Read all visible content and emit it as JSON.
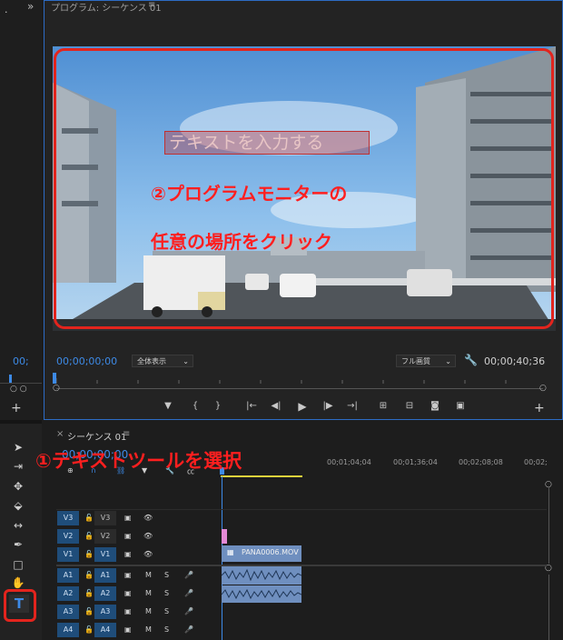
{
  "left_panel": {
    "chevron": "»",
    "timecode": "00;",
    "add": "+"
  },
  "program": {
    "title": "プログラム: シーケンス 01",
    "menu_icon": "≡",
    "timecode_left": "00;00;00;00",
    "fit_label": "全体表示",
    "quality_label": "フル画質",
    "timecode_right": "00;00;40;36",
    "overlay_text": "テキストを入力する",
    "annotation_line1": "②プログラムモニターの",
    "annotation_line2": "任意の場所をクリック",
    "add": "+"
  },
  "timeline": {
    "close": "×",
    "tab_title": "シーケンス 01",
    "menu_icon": "≡",
    "timecode": "00;00;00;00",
    "annotation": "①テキストツールを選択",
    "ruler_marks": [
      "00;01;04;04",
      "00;01;36;04",
      "00;02;08;08",
      "00;02;"
    ],
    "tracks": [
      {
        "src": "V3",
        "dst": "V3"
      },
      {
        "src": "V2",
        "dst": "V2"
      },
      {
        "src": "V1",
        "dst": "V1"
      },
      {
        "src": "A1",
        "dst": "A1"
      },
      {
        "src": "A2",
        "dst": "A2"
      },
      {
        "src": "A3",
        "dst": "A3"
      },
      {
        "src": "A4",
        "dst": "A4"
      }
    ],
    "clip_name": "PANA0006.MOV",
    "m_label": "M",
    "s_label": "S"
  },
  "tools": [
    "select-tool",
    "track-select-tool",
    "ripple-tool",
    "razor-tool",
    "slip-tool",
    "pen-tool",
    "rectangle-tool",
    "hand-tool",
    "type-tool"
  ],
  "type_tool_glyph": "T"
}
